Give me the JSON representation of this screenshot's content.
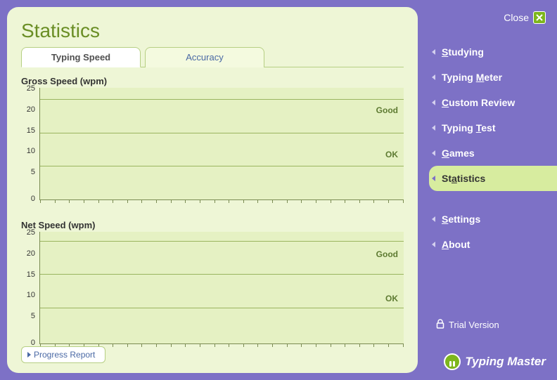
{
  "title": "Statistics",
  "close_label": "Close",
  "tabs": [
    {
      "label": "Typing Speed",
      "active": true
    },
    {
      "label": "Accuracy",
      "active": false
    }
  ],
  "nav": [
    {
      "label": "Studying",
      "mnemonic_index": 0,
      "active": false
    },
    {
      "label": "Typing Meter",
      "mnemonic_index": 7,
      "active": false
    },
    {
      "label": "Custom Review",
      "mnemonic_index": 0,
      "active": false
    },
    {
      "label": "Typing Test",
      "mnemonic_index": 7,
      "active": false
    },
    {
      "label": "Games",
      "mnemonic_index": 0,
      "active": false
    },
    {
      "label": "Statistics",
      "mnemonic_index": 2,
      "active": true
    },
    {
      "divider": true
    },
    {
      "label": "Settings",
      "mnemonic_index": 0,
      "active": false
    },
    {
      "label": "About",
      "mnemonic_index": 0,
      "active": false
    }
  ],
  "trial_label": "Trial Version",
  "brand_name": "Typing Master",
  "progress_report_label": "Progress Report",
  "chart_data": [
    {
      "type": "line",
      "title": "Gross Speed (wpm)",
      "xlabel": "",
      "ylabel": "",
      "ylim": [
        0,
        25
      ],
      "y_ticks": [
        25,
        20,
        15,
        10,
        5,
        0
      ],
      "series": [
        {
          "name": "gross_wpm",
          "values": []
        }
      ],
      "bands": [
        {
          "label": "Good",
          "y": 20
        },
        {
          "label": "OK",
          "y": 10
        }
      ],
      "gridlines_y": [
        7.5,
        15,
        22.5
      ],
      "x_tick_count": 26
    },
    {
      "type": "line",
      "title": "Net Speed (wpm)",
      "xlabel": "",
      "ylabel": "",
      "ylim": [
        0,
        25
      ],
      "y_ticks": [
        25,
        20,
        15,
        10,
        5,
        0
      ],
      "series": [
        {
          "name": "net_wpm",
          "values": []
        }
      ],
      "bands": [
        {
          "label": "Good",
          "y": 20
        },
        {
          "label": "OK",
          "y": 10
        }
      ],
      "gridlines_y": [
        8,
        15.5,
        23
      ],
      "x_tick_count": 26
    }
  ]
}
